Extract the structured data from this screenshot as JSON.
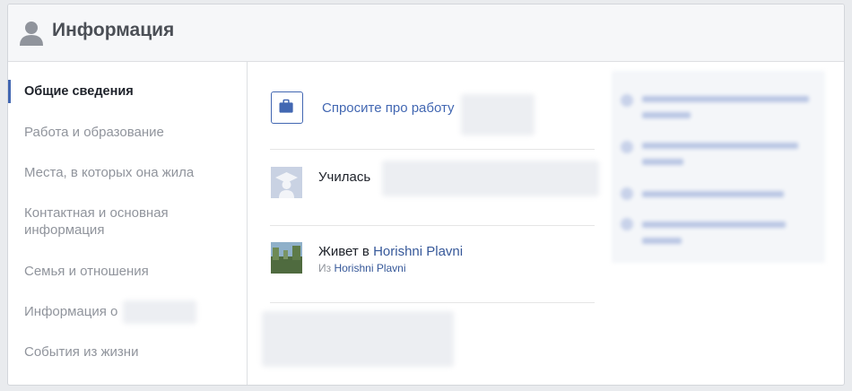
{
  "header": {
    "title": "Информация"
  },
  "sidebar": {
    "items": [
      {
        "label": "Общие сведения"
      },
      {
        "label": "Работа и образование"
      },
      {
        "label": "Места, в которых она жила"
      },
      {
        "label": "Контактная и основная информация"
      },
      {
        "label": "Семья и отношения"
      },
      {
        "label": "Информация о"
      },
      {
        "label": "События из жизни"
      }
    ]
  },
  "main": {
    "work": {
      "label": "Спросите про работу"
    },
    "education": {
      "prefix": "Училась"
    },
    "lives": {
      "prefix": "Живет в ",
      "city": "Horishni Plavni",
      "from_prefix": "Из ",
      "from_city": "Horishni Plavni"
    }
  },
  "icons": {
    "user": "user-silhouette-icon",
    "work": "briefcase-icon",
    "education": "graduation-cap-icon",
    "lives": "location-photo-icon"
  },
  "colors": {
    "accent": "#4267b2",
    "link": "#365899"
  }
}
